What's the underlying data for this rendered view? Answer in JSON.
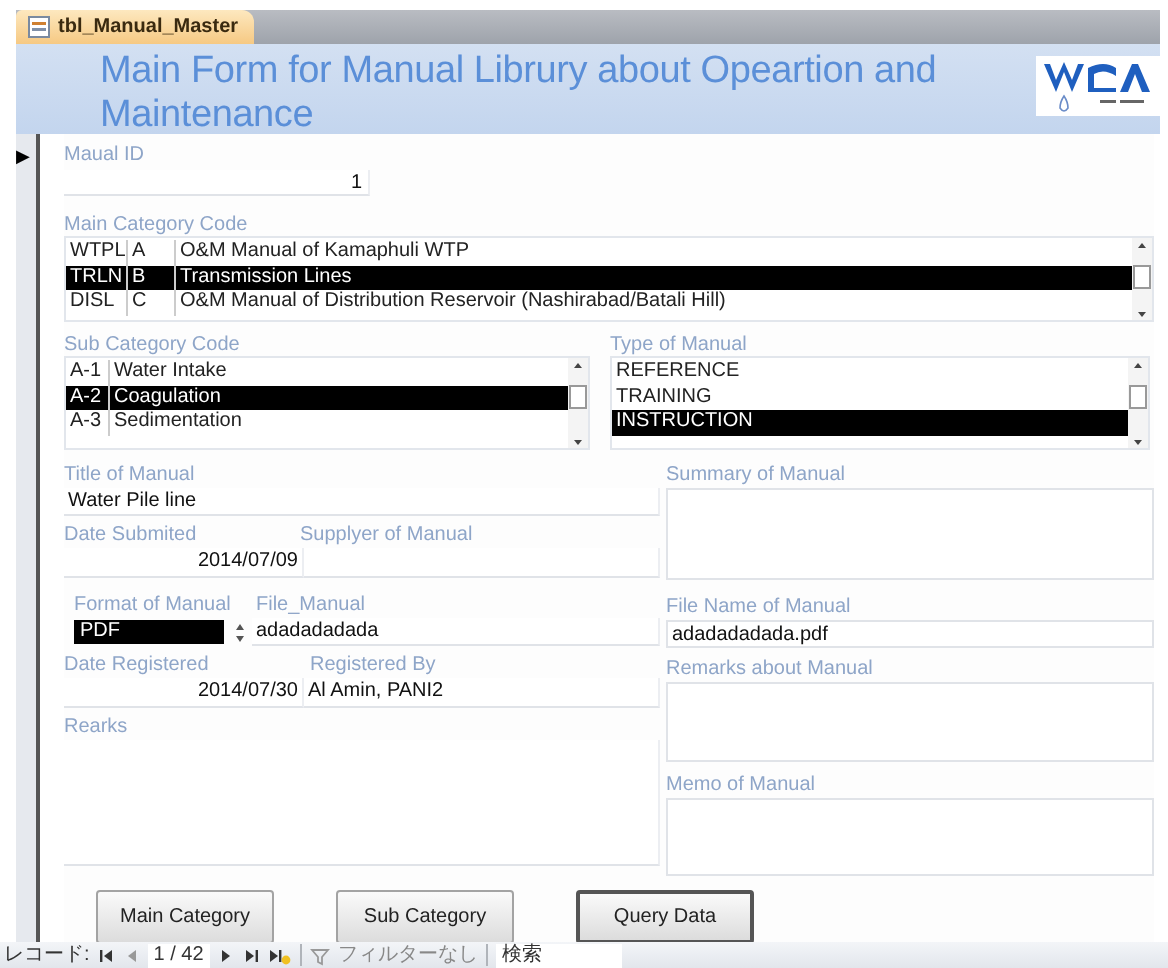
{
  "tab": {
    "title": "tbl_Manual_Master",
    "selected": true
  },
  "header": {
    "title": "Main Form for Manual Librury about Opeartion and Maintenance"
  },
  "record_selector": {
    "marker": "▶"
  },
  "manual_id": {
    "label": "Maual ID",
    "value": "1"
  },
  "main_category": {
    "label": "Main Category Code",
    "rows": [
      {
        "cells": [
          "WTPL",
          "A",
          "O&M Manual of Kamaphuli WTP"
        ],
        "selected": false
      },
      {
        "cells": [
          "TRLN",
          "B",
          "Transmission Lines"
        ],
        "selected": true
      },
      {
        "cells": [
          "DISL",
          "C",
          "O&M Manual of Distribution Reservoir (Nashirabad/Batali Hill)"
        ],
        "selected": false
      }
    ]
  },
  "sub_category": {
    "label": "Sub Category Code",
    "rows": [
      {
        "cells": [
          "A-1",
          "Water Intake"
        ],
        "selected": false
      },
      {
        "cells": [
          "A-2",
          "Coagulation"
        ],
        "selected": true
      },
      {
        "cells": [
          "A-3",
          "Sedimentation"
        ],
        "selected": false
      }
    ]
  },
  "type_of_manual": {
    "label": "Type of Manual",
    "rows": [
      {
        "cells": [
          "REFERENCE"
        ],
        "selected": false
      },
      {
        "cells": [
          "TRAINING"
        ],
        "selected": false
      },
      {
        "cells": [
          "INSTRUCTION"
        ],
        "selected": true
      }
    ]
  },
  "title_of_manual": {
    "label": "Title of Manual",
    "value": "Water Pile line"
  },
  "summary_of_manual": {
    "label": "Summary of Manual"
  },
  "date_submitted": {
    "label": "Date Submited",
    "value": "2014/07/09"
  },
  "supplier": {
    "label": "Supplyer of Manual"
  },
  "format_of_manual": {
    "label": "Format of Manual",
    "value": "PDF"
  },
  "file_manual": {
    "label": "File_Manual",
    "value": "adadadadada"
  },
  "file_name": {
    "label": "File Name of Manual",
    "value": "adadadadada.pdf"
  },
  "date_registered": {
    "label": "Date Registered",
    "value": "2014/07/30"
  },
  "registered_by": {
    "label": "Registered By",
    "value": "Al Amin, PANI2"
  },
  "remarks_about_manual": {
    "label": "Remarks about Manual"
  },
  "remarks": {
    "label": "Rearks"
  },
  "memo_of_manual": {
    "label": "Memo of Manual"
  },
  "buttons": [
    {
      "label": "Main Category",
      "focused": false
    },
    {
      "label": "Sub Category",
      "focused": false
    },
    {
      "label": "Query Data",
      "focused": true
    }
  ],
  "status_bar": {
    "record_label": "レコード:",
    "position": "1 / 42",
    "filter": "フィルターなし",
    "search": "検索"
  }
}
